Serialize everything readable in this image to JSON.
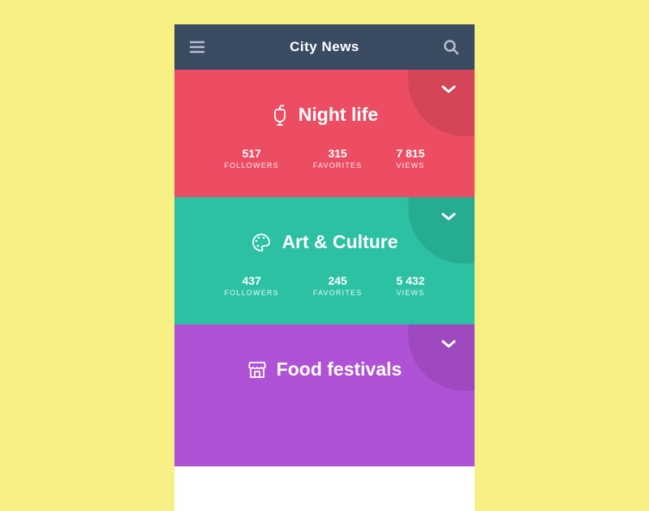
{
  "header": {
    "title": "City News"
  },
  "cards": [
    {
      "icon": "drink-icon",
      "title": "Night life",
      "stats": {
        "followers": {
          "value": "517",
          "label": "FOLLOWERS"
        },
        "favorites": {
          "value": "315",
          "label": "FAVORITES"
        },
        "views": {
          "value": "7 815",
          "label": "VIEWS"
        }
      },
      "color": "#ec4d63"
    },
    {
      "icon": "palette-icon",
      "title": "Art & Culture",
      "stats": {
        "followers": {
          "value": "437",
          "label": "FOLLOWERS"
        },
        "favorites": {
          "value": "245",
          "label": "FAVORITES"
        },
        "views": {
          "value": "5 432",
          "label": "VIEWS"
        }
      },
      "color": "#2bc1a2"
    },
    {
      "icon": "store-icon",
      "title": "Food festivals",
      "color": "#b052d6"
    }
  ]
}
